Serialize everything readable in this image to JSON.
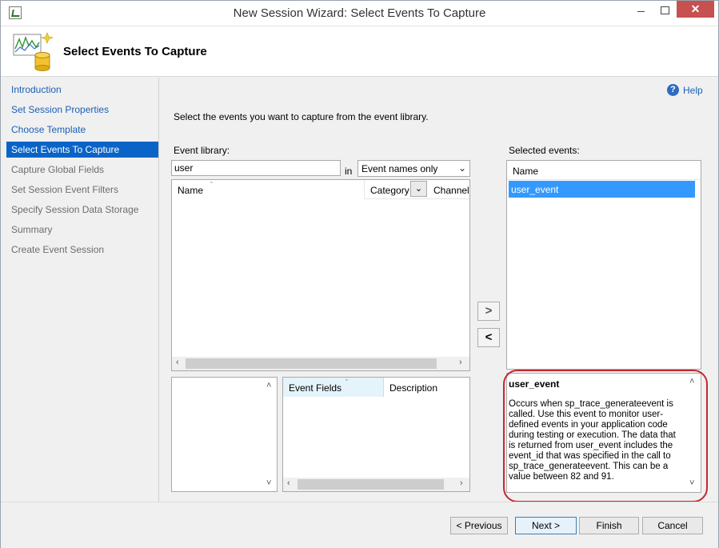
{
  "window": {
    "title": "New Session Wizard: Select Events To Capture",
    "close_glyph": "✕"
  },
  "header": {
    "title": "Select Events To Capture"
  },
  "nav": {
    "items": [
      {
        "label": "Introduction",
        "state": "link"
      },
      {
        "label": "Set Session Properties",
        "state": "link"
      },
      {
        "label": "Choose Template",
        "state": "link"
      },
      {
        "label": "Select Events To Capture",
        "state": "active"
      },
      {
        "label": "Capture Global Fields",
        "state": "disabled"
      },
      {
        "label": "Set Session Event Filters",
        "state": "disabled"
      },
      {
        "label": "Specify Session Data Storage",
        "state": "disabled"
      },
      {
        "label": "Summary",
        "state": "disabled"
      },
      {
        "label": "Create Event Session",
        "state": "disabled"
      }
    ]
  },
  "help": {
    "label": "Help",
    "icon": "?"
  },
  "content": {
    "instruction": "Select the events you want to capture from the event library."
  },
  "event_library": {
    "label": "Event library:",
    "search_value": "user",
    "in_label": "in",
    "filter_selected": "Event names only",
    "columns": [
      "Name",
      "Category",
      "Channel"
    ]
  },
  "event_fields": {
    "columns": [
      "Event Fields",
      "Description"
    ]
  },
  "buttons": {
    "add": ">",
    "remove": "<",
    "previous": "< Previous",
    "next": "Next >",
    "finish": "Finish",
    "cancel": "Cancel"
  },
  "selected_events": {
    "label": "Selected events:",
    "column": "Name",
    "items": [
      "user_event"
    ]
  },
  "description": {
    "title": "user_event",
    "body": "Occurs when sp_trace_generateevent is called. Use this event to monitor user-defined events in your application code during testing or execution. The data that is returned from user_event includes the event_id that was specified in the call to sp_trace_generateevent. This can be a value between 82 and 91."
  },
  "colors": {
    "accent": "#0a64c8",
    "selection": "#3399ff",
    "highlight": "#c6262e",
    "close_button": "#c75050"
  }
}
